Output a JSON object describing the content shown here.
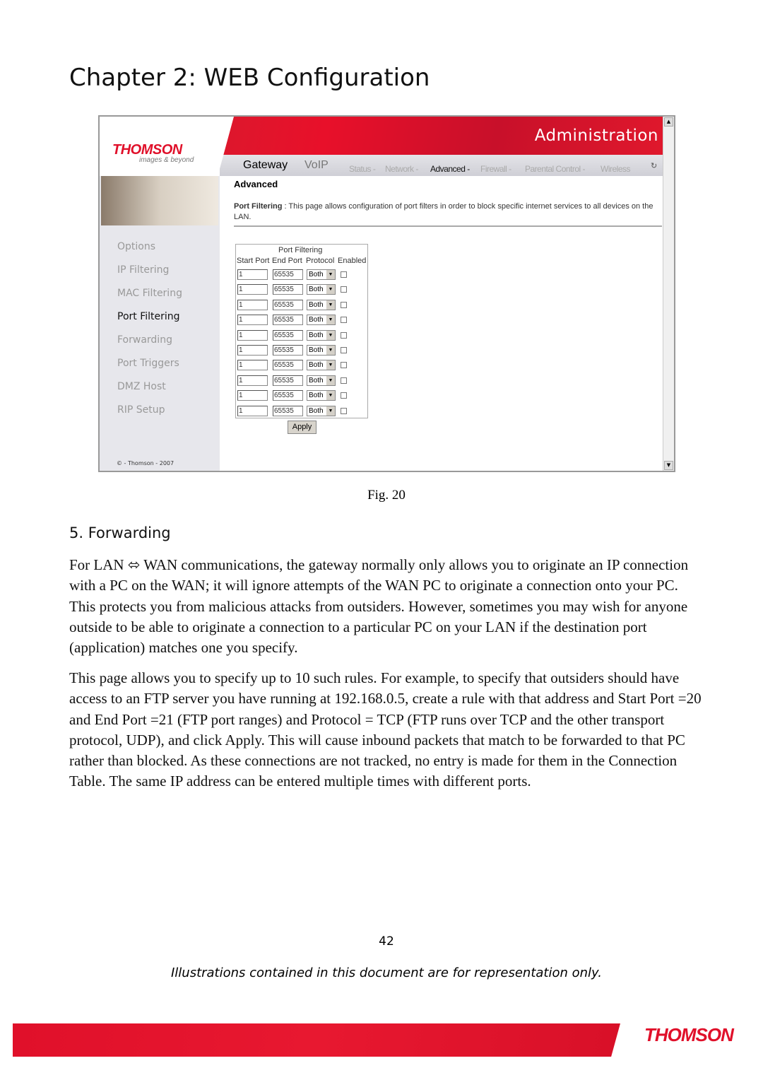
{
  "page_title": "Chapter 2: WEB Configuration",
  "screenshot": {
    "logo": "THOMSON",
    "logo_tagline": "images & beyond",
    "header_title": "Administration",
    "nav_main": [
      "Gateway",
      "VoIP"
    ],
    "nav_sub": [
      "Status -",
      "Network -",
      "Advanced -",
      "Firewall -",
      "Parental Control -",
      "Wireless"
    ],
    "nav_active": "Advanced -",
    "sidebar": [
      "Options",
      "IP Filtering",
      "MAC Filtering",
      "Port Filtering",
      "Forwarding",
      "Port Triggers",
      "DMZ Host",
      "RIP Setup"
    ],
    "sidebar_active": "Port Filtering",
    "copyright": "© - Thomson - 2007",
    "section_title": "Advanced",
    "desc_label": "Port Filtering",
    "desc_text": " :  This page allows configuration of port filters in order to block specific internet services to all devices on the LAN.",
    "table": {
      "caption": "Port Filtering",
      "headers": [
        "Start Port",
        "End Port",
        "Protocol",
        "Enabled"
      ],
      "rows": [
        {
          "start": "1",
          "end": "65535",
          "protocol": "Both",
          "enabled": false
        },
        {
          "start": "1",
          "end": "65535",
          "protocol": "Both",
          "enabled": false
        },
        {
          "start": "1",
          "end": "65535",
          "protocol": "Both",
          "enabled": false
        },
        {
          "start": "1",
          "end": "65535",
          "protocol": "Both",
          "enabled": false
        },
        {
          "start": "1",
          "end": "65535",
          "protocol": "Both",
          "enabled": false
        },
        {
          "start": "1",
          "end": "65535",
          "protocol": "Both",
          "enabled": false
        },
        {
          "start": "1",
          "end": "65535",
          "protocol": "Both",
          "enabled": false
        },
        {
          "start": "1",
          "end": "65535",
          "protocol": "Both",
          "enabled": false
        },
        {
          "start": "1",
          "end": "65535",
          "protocol": "Both",
          "enabled": false
        },
        {
          "start": "1",
          "end": "65535",
          "protocol": "Both",
          "enabled": false
        }
      ]
    },
    "apply_label": "Apply"
  },
  "figure_caption": "Fig. 20",
  "section_heading": "5. Forwarding",
  "paragraphs": [
    "For LAN ⬄ WAN communications, the gateway normally only allows you to originate an IP connection with a PC on the WAN; it will ignore attempts of the WAN PC to originate a connection onto your PC. This protects you from malicious attacks from outsiders. However, sometimes you may wish for anyone outside to be able to originate a connection to a particular PC on your LAN if the destination port (application) matches one you specify.",
    "This page allows you to specify up to 10 such rules. For example, to specify that outsiders should have access to an FTP server you have running at 192.168.0.5, create a rule with that address and Start Port =20 and End Port =21 (FTP port ranges) and Protocol = TCP (FTP runs over TCP and the other transport protocol, UDP), and click Apply. This will cause inbound packets that match to be forwarded to that PC rather than blocked. As these connections are not tracked, no entry is made for them in the Connection Table. The same IP address can be entered multiple times with different ports."
  ],
  "page_number": "42",
  "footer_note": "Illustrations contained in this document are for representation only.",
  "footer_logo": "THOMSON",
  "colors": {
    "brand_red": "#e0102a"
  }
}
